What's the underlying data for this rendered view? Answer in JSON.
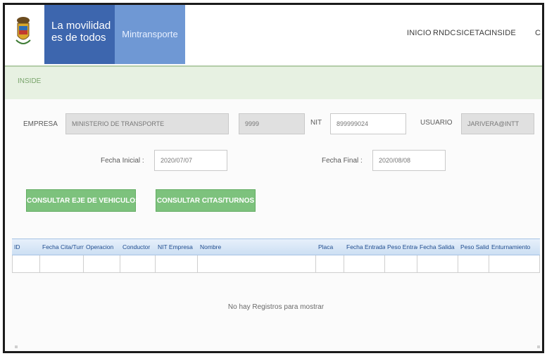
{
  "header": {
    "brand_line1": "La movilidad",
    "brand_line2": "es de todos",
    "ministry": "Mintransporte",
    "nav": [
      "INICIO",
      "RNDC",
      "SICETAC",
      "INSIDE",
      "C"
    ]
  },
  "breadcrumb": "INSIDE",
  "form": {
    "empresa_label": "EMPRESA",
    "empresa_value": "MINISTERIO DE TRANSPORTE",
    "code_value": "9999",
    "nit_label": "NIT",
    "nit_value": "899999024",
    "usuario_label": "USUARIO",
    "usuario_value": "JARIVERA@INTT",
    "fecha_inicial_label": "Fecha Inicial :",
    "fecha_inicial_value": "2020/07/07",
    "fecha_final_label": "Fecha Final :",
    "fecha_final_value": "2020/08/08"
  },
  "buttons": {
    "vehicles": "CONSULTAR EJE DE VEHICULOS",
    "turnos": "CONSULTAR CITAS/TURNOS"
  },
  "table": {
    "columns": [
      "ID",
      "Fecha Cita/Turno",
      "Operacion",
      "Conductor",
      "NIT Empresa",
      "Nombre",
      "Placa",
      "Fecha Entrada",
      "Peso Entrada",
      "Fecha Salida",
      "Peso Salida",
      "Enturnamiento"
    ],
    "empty_message": "No hay Registros para mostrar"
  },
  "colors": {
    "brand_blue": "#3d66ae",
    "ministry_blue": "#6f98d4",
    "button_green": "#7dc27d",
    "breadcrumb_green": "#e7f1e2"
  }
}
